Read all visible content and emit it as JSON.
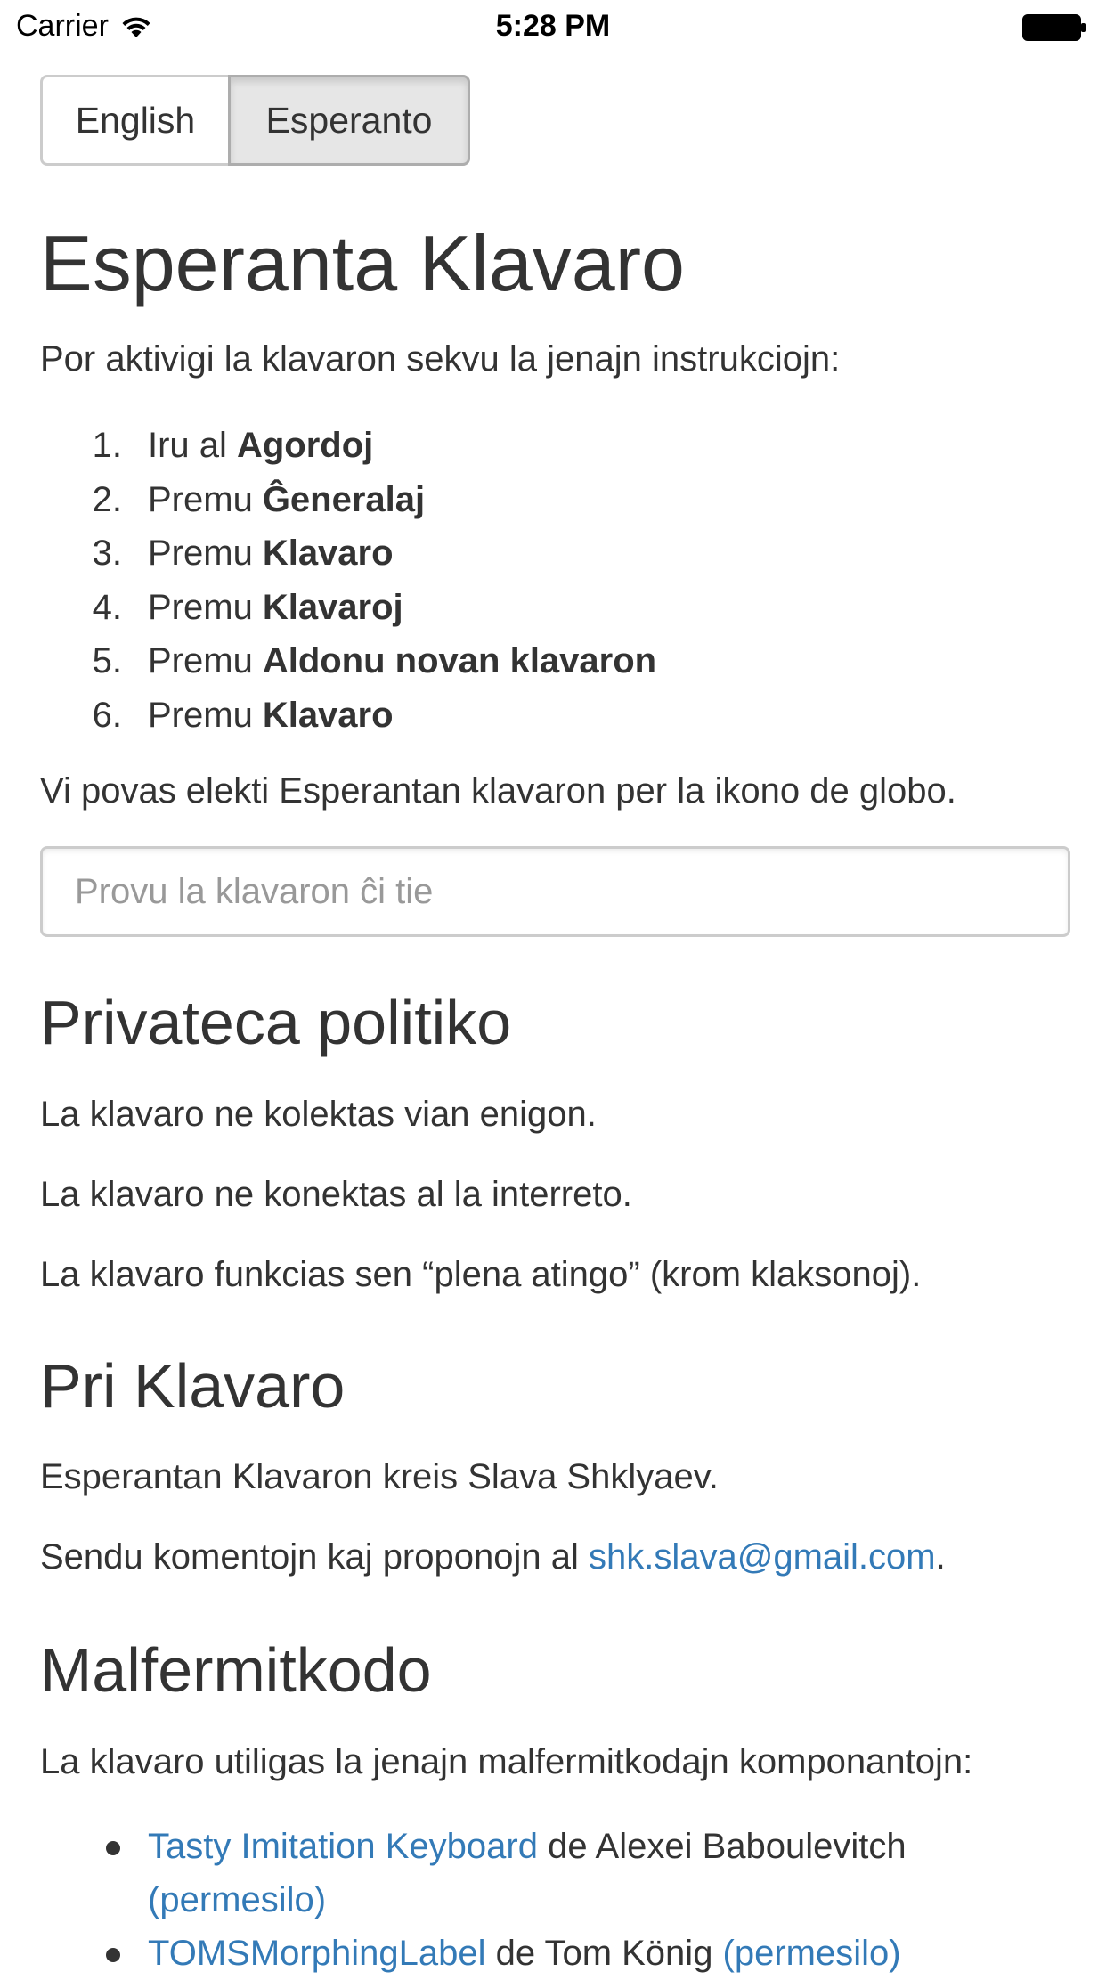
{
  "status_bar": {
    "carrier": "Carrier",
    "time": "5:28 PM"
  },
  "language_switch": {
    "options": [
      "English",
      "Esperanto"
    ],
    "selected": "Esperanto"
  },
  "main": {
    "title": "Esperanta Klavaro",
    "intro": "Por aktivigi la klavaron sekvu la jenajn instrukciojn:",
    "steps": [
      {
        "num": "1.",
        "verb": "Iru al",
        "target": "Agordoj"
      },
      {
        "num": "2.",
        "verb": "Premu",
        "target": "Ĝeneralaj"
      },
      {
        "num": "3.",
        "verb": "Premu",
        "target": "Klavaro"
      },
      {
        "num": "4.",
        "verb": "Premu",
        "target": "Klavaroj"
      },
      {
        "num": "5.",
        "verb": "Premu",
        "target": "Aldonu novan klavaron"
      },
      {
        "num": "6.",
        "verb": "Premu",
        "target": "Klavaro"
      }
    ],
    "globe_note": "Vi povas elekti Esperantan klavaron per la ikono de globo.",
    "test_input_placeholder": "Provu la klavaron ĉi tie"
  },
  "privacy": {
    "heading": "Privateca politiko",
    "lines": [
      "La klavaro ne kolektas vian enigon.",
      "La klavaro ne konektas al la interreto.",
      "La klavaro funkcias sen “plena atingo” (krom klaksonoj)."
    ]
  },
  "about": {
    "heading": "Pri Klavaro",
    "author_line": "Esperantan Klavaron kreis Slava Shklyaev.",
    "feedback_prefix": "Sendu komentojn kaj proponojn al ",
    "email": "shk.slava@gmail.com",
    "feedback_suffix": "."
  },
  "open_source": {
    "heading": "Malfermitkodo",
    "intro": "La klavaro utiligas la jenajn malfermitkodajn komponantojn:",
    "components": [
      {
        "name": "Tasty Imitation Keyboard",
        "by": " de Alexei Baboulevitch ",
        "license": "(permesilo)"
      },
      {
        "name": "TOMSMorphingLabel",
        "by": " de Tom König ",
        "license": "(permesilo)"
      }
    ]
  },
  "colors": {
    "text": "#333333",
    "link": "#337ab7",
    "border": "#cccccc",
    "selected_segment": "#e6e6e6"
  }
}
